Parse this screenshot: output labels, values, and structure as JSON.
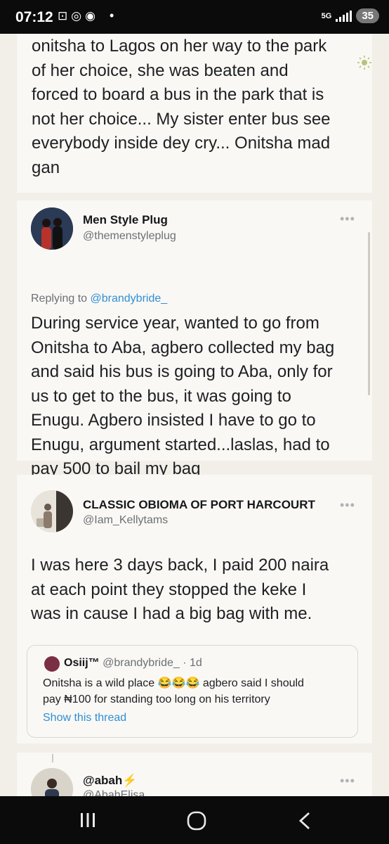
{
  "status_bar": {
    "time": "07:12",
    "battery": "35",
    "network": "5G"
  },
  "top_tweet": {
    "lines": [
      "onitsha to Lagos on her way to the park",
      "of her choice, she was beaten and",
      "forced to board a bus in the park that is",
      "not her choice... My sister enter bus see",
      "everybody inside dey cry... Onitsha mad",
      "gan"
    ]
  },
  "tweet1": {
    "name": "Men Style Plug",
    "handle": "@themenstyleplug",
    "replying_prefix": "Replying to ",
    "replying_handle": "@brandybride_",
    "lines": [
      "During service year, wanted to go from",
      "Onitsha to Aba, agbero collected my bag",
      "and said his bus is going to Aba, only for",
      "us to get to the bus, it was going to",
      "Enugu. Agbero insisted I have to go to",
      "Enugu, argument started...laslas, had to",
      "pay 500 to bail my bag"
    ]
  },
  "tweet2": {
    "name": "CLASSIC OBIOMA OF PORT HARCOURT",
    "handle": "@Iam_Kellytams",
    "lines": [
      "I was here 3 days back, I paid 200 naira",
      "at each point they stopped the keke I",
      "was in cause I had a big bag with me."
    ],
    "quote": {
      "name": "Osiij™",
      "handle": "@brandybride_",
      "time": "· 1d",
      "line1_a": "Onitsha is a wild place ",
      "emojis": "😂😂😂",
      "line1_b": " agbero said I should",
      "line2": "pay ₦100 for standing too long on his territory",
      "show_thread": "Show this thread"
    }
  },
  "tweet3": {
    "name": "@abah",
    "bolt": "⚡",
    "handle_partial": "@AbahElisa"
  },
  "icons": {
    "more": "more-options-icon",
    "brightness": "sun-icon",
    "nav_recent": "recent-apps-icon",
    "nav_home": "home-icon",
    "nav_back": "back-icon"
  },
  "colors": {
    "link": "#2f8fd6",
    "text": "#1d1f22",
    "muted": "#6b7075",
    "background": "#f2efe9",
    "card": "#faf8f4"
  }
}
